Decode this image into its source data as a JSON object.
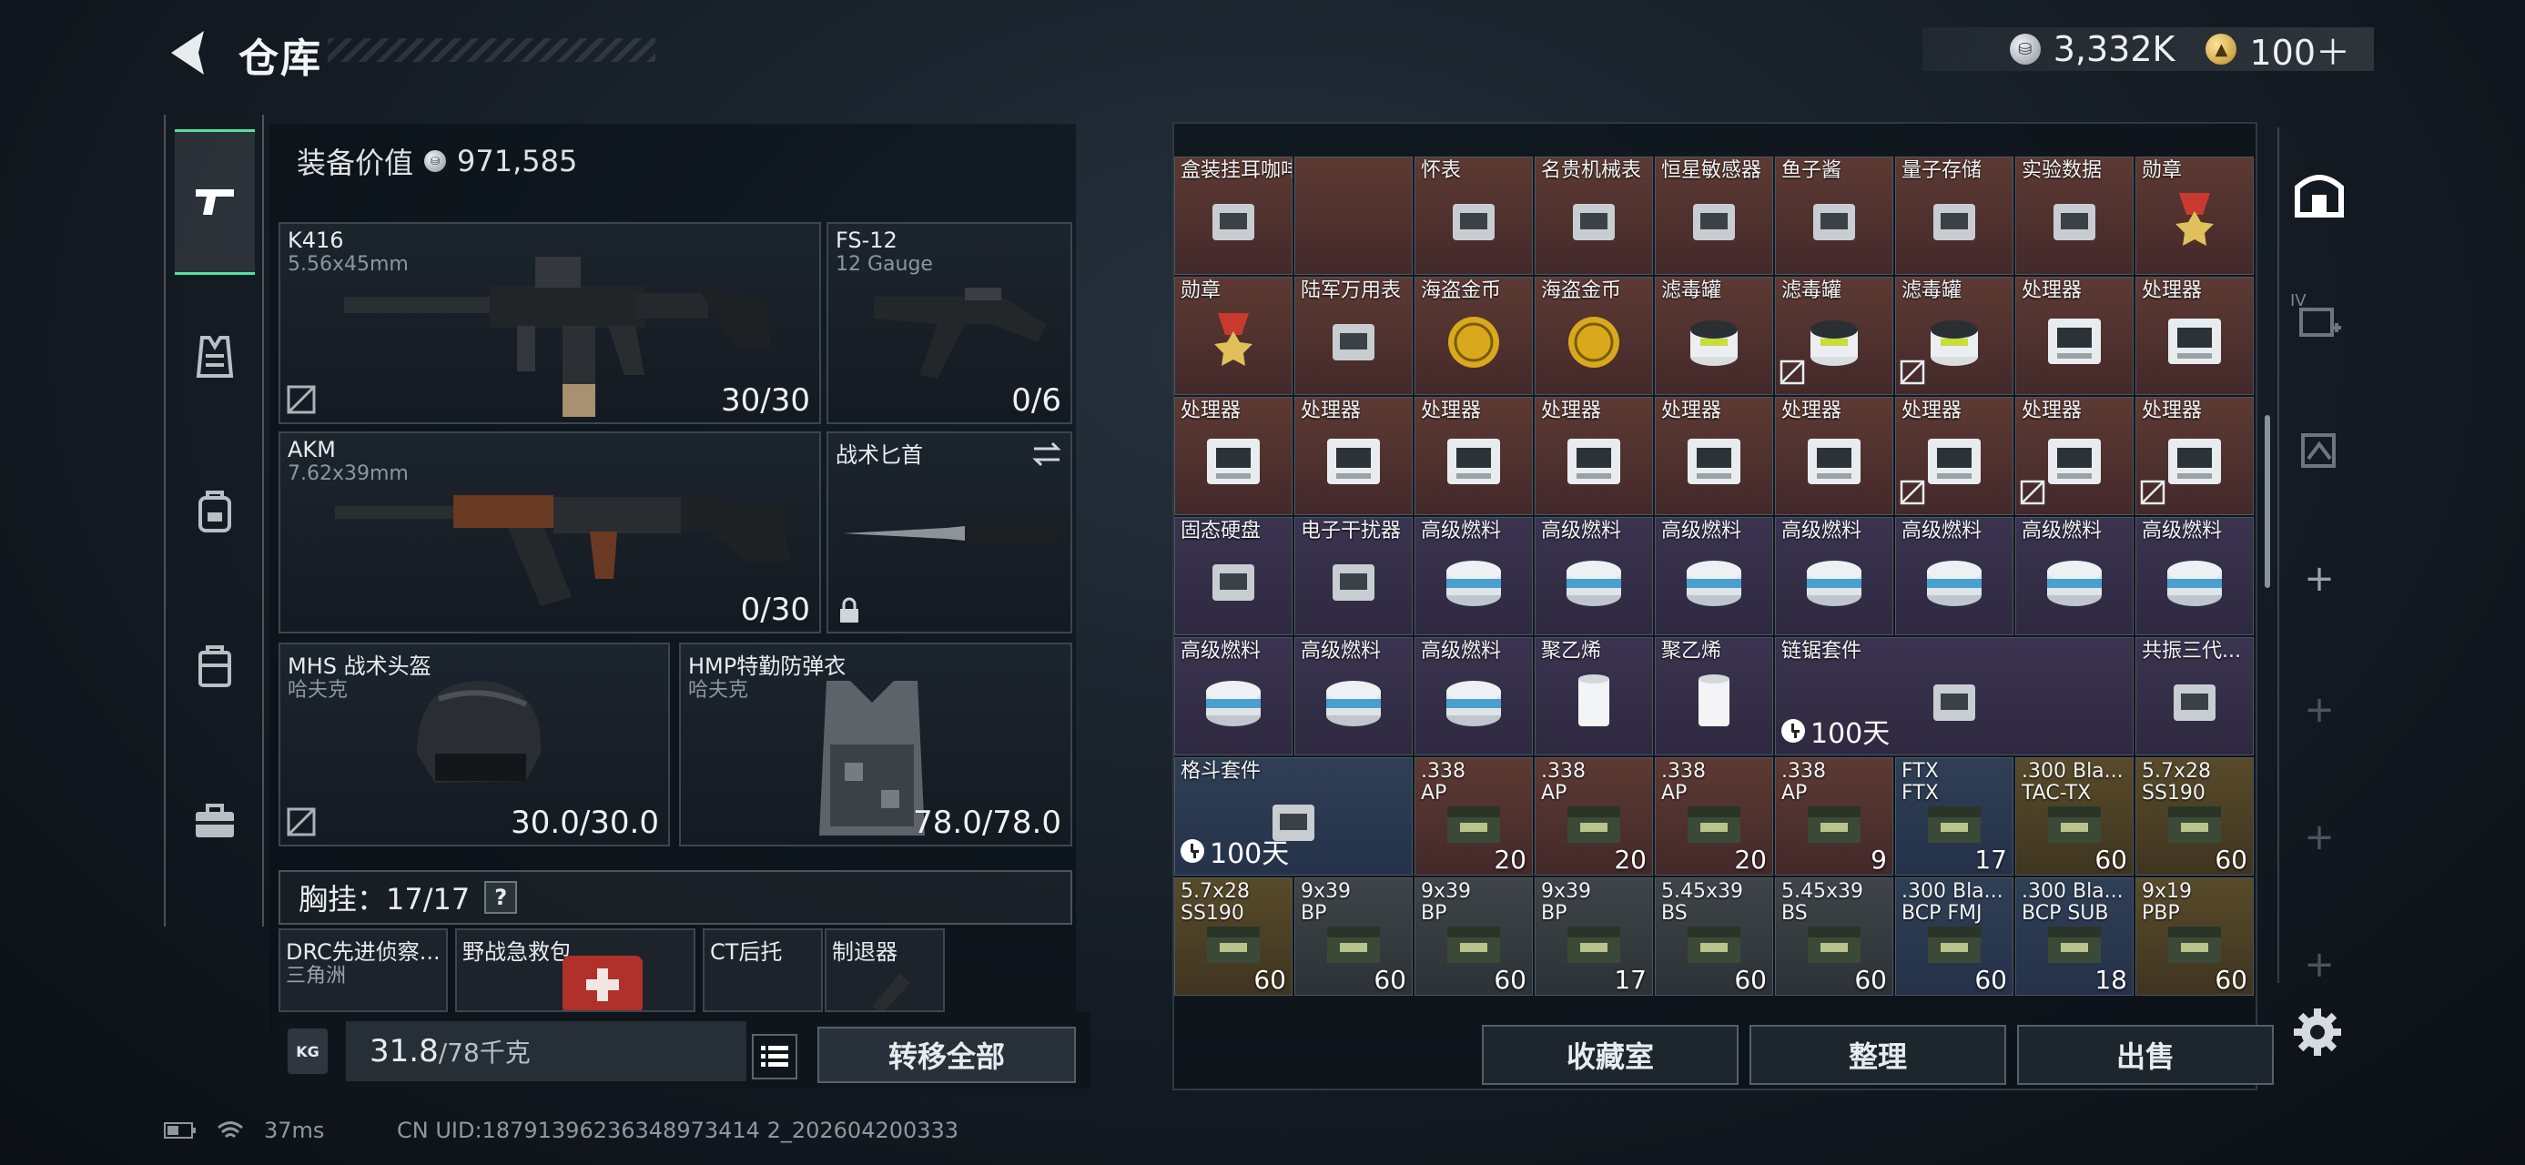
{
  "header": {
    "title": "仓库",
    "silver": "3,332K",
    "gold": "100＋"
  },
  "loadout": {
    "equip_value_label": "装备价值",
    "equip_value": "971,585",
    "slots": {
      "primary": {
        "name": "K416",
        "sub": "5.56x45mm",
        "count": "30/30"
      },
      "secondary": {
        "name": "FS-12",
        "sub": "12 Gauge",
        "count": "0/6"
      },
      "primary2": {
        "name": "AKM",
        "sub": "7.62x39mm",
        "count": "0/30"
      },
      "melee": {
        "name": "战术匕首"
      },
      "helmet": {
        "name": "MHS 战术头盔",
        "sub": "哈夫克",
        "count": "30.0/30.0"
      },
      "armor": {
        "name": "HMP特勤防弹衣",
        "sub": "哈夫克",
        "count": "78.0/78.0"
      }
    },
    "rig_label": "胸挂：17/17",
    "rig_help": "?",
    "pockets": [
      {
        "name": "DRC先进侦察...",
        "sub": "三角洲"
      },
      {
        "name": "野战急救包"
      },
      {
        "name": "CT后托"
      },
      {
        "name": "制退器"
      }
    ],
    "weight_icon": "KG",
    "weight_current": "31.8",
    "weight_max": "/78千克",
    "transfer_all": "转移全部"
  },
  "stash": {
    "rows": [
      [
        {
          "name": "盒装挂耳咖啡",
          "bg": "r",
          "icon": "coffee-box-icon"
        },
        {
          "name": "",
          "bg": "r",
          "icon": ""
        },
        {
          "name": "怀表",
          "bg": "r",
          "icon": "pocket-watch-icon"
        },
        {
          "name": "名贵机械表",
          "bg": "r",
          "icon": "luxury-watch-icon"
        },
        {
          "name": "恒星敏感器",
          "bg": "r",
          "icon": "star-sensor-icon"
        },
        {
          "name": "鱼子酱",
          "bg": "r",
          "icon": "caviar-icon"
        },
        {
          "name": "量子存储",
          "bg": "r",
          "icon": "quantum-storage-icon"
        },
        {
          "name": "实验数据",
          "bg": "r",
          "icon": "data-disc-icon"
        },
        {
          "name": "勋章",
          "bg": "r",
          "icon": "medal-icon"
        }
      ],
      [
        {
          "name": "勋章",
          "bg": "r",
          "icon": "medal-icon"
        },
        {
          "name": "陆军万用表",
          "bg": "r",
          "icon": "multimeter-icon"
        },
        {
          "name": "海盗金币",
          "bg": "r",
          "icon": "gold-coin-icon"
        },
        {
          "name": "海盗金币",
          "bg": "r",
          "icon": "gold-coin-icon"
        },
        {
          "name": "滤毒罐",
          "bg": "r",
          "icon": "filter-canister-icon"
        },
        {
          "name": "滤毒罐",
          "bg": "r",
          "icon": "filter-canister-icon",
          "mark": true
        },
        {
          "name": "滤毒罐",
          "bg": "r",
          "icon": "filter-canister-icon",
          "mark": true
        },
        {
          "name": "处理器",
          "bg": "r",
          "icon": "processor-icon"
        },
        {
          "name": "处理器",
          "bg": "r",
          "icon": "processor-icon"
        }
      ],
      [
        {
          "name": "处理器",
          "bg": "r",
          "icon": "processor-icon"
        },
        {
          "name": "处理器",
          "bg": "r",
          "icon": "processor-icon"
        },
        {
          "name": "处理器",
          "bg": "r",
          "icon": "processor-icon"
        },
        {
          "name": "处理器",
          "bg": "r",
          "icon": "processor-icon"
        },
        {
          "name": "处理器",
          "bg": "r",
          "icon": "processor-icon"
        },
        {
          "name": "处理器",
          "bg": "r",
          "icon": "processor-icon"
        },
        {
          "name": "处理器",
          "bg": "r",
          "icon": "processor-icon",
          "mark": true
        },
        {
          "name": "处理器",
          "bg": "r",
          "icon": "processor-icon",
          "mark": true
        },
        {
          "name": "处理器",
          "bg": "r",
          "icon": "processor-icon",
          "mark": true
        }
      ],
      [
        {
          "name": "固态硬盘",
          "bg": "p",
          "icon": "ssd-icon"
        },
        {
          "name": "电子干扰器",
          "bg": "p",
          "icon": "jammer-icon"
        },
        {
          "name": "高级燃料",
          "bg": "p",
          "icon": "fuel-can-icon"
        },
        {
          "name": "高级燃料",
          "bg": "p",
          "icon": "fuel-can-icon"
        },
        {
          "name": "高级燃料",
          "bg": "p",
          "icon": "fuel-can-icon"
        },
        {
          "name": "高级燃料",
          "bg": "p",
          "icon": "fuel-can-icon"
        },
        {
          "name": "高级燃料",
          "bg": "p",
          "icon": "fuel-can-icon"
        },
        {
          "name": "高级燃料",
          "bg": "p",
          "icon": "fuel-can-icon"
        },
        {
          "name": "高级燃料",
          "bg": "p",
          "icon": "fuel-can-icon"
        }
      ],
      [
        {
          "name": "高级燃料",
          "bg": "p",
          "icon": "fuel-can-icon"
        },
        {
          "name": "高级燃料",
          "bg": "p",
          "icon": "fuel-can-icon"
        },
        {
          "name": "高级燃料",
          "bg": "p",
          "icon": "fuel-can-icon"
        },
        {
          "name": "聚乙烯",
          "bg": "p",
          "icon": "polyethylene-roll-icon"
        },
        {
          "name": "聚乙烯",
          "bg": "p",
          "icon": "polyethylene-roll-icon"
        },
        {
          "name": "链锯套件",
          "bg": "p",
          "icon": "chainsaw-kit-icon",
          "span": 3,
          "timer": "100天"
        },
        null,
        null,
        {
          "name": "共振三代...",
          "bg": "p",
          "icon": "foregrip-icon"
        }
      ],
      [
        {
          "name": "格斗套件",
          "bg": "b",
          "icon": "combat-kit-icon",
          "span": 2,
          "timer": "100天"
        },
        null,
        {
          "name": ".338",
          "name2": "AP",
          "bg": "r",
          "icon": "ammo-box-icon",
          "qty": "20"
        },
        {
          "name": ".338",
          "name2": "AP",
          "bg": "r",
          "icon": "ammo-box-icon",
          "qty": "20"
        },
        {
          "name": ".338",
          "name2": "AP",
          "bg": "r",
          "icon": "ammo-box-icon",
          "qty": "20"
        },
        {
          "name": ".338",
          "name2": "AP",
          "bg": "r",
          "icon": "ammo-box-icon",
          "qty": "9"
        },
        {
          "name": "FTX",
          "name2": "FTX",
          "bg": "b",
          "icon": "ammo-box-icon",
          "qty": "17"
        },
        {
          "name": ".300 Bla...",
          "name2": "TAC-TX",
          "bg": "y",
          "icon": "ammo-box-icon",
          "qty": "60"
        },
        {
          "name": "5.7x28",
          "name2": "SS190",
          "bg": "y",
          "icon": "ammo-box-icon",
          "qty": "60"
        }
      ],
      [
        {
          "name": "5.7x28",
          "name2": "SS190",
          "bg": "y",
          "icon": "ammo-box-icon",
          "qty": "60"
        },
        {
          "name": "9x39",
          "name2": "BP",
          "bg": "g",
          "icon": "ammo-box-icon",
          "qty": "60"
        },
        {
          "name": "9x39",
          "name2": "BP",
          "bg": "g",
          "icon": "ammo-box-icon",
          "qty": "60"
        },
        {
          "name": "9x39",
          "name2": "BP",
          "bg": "g",
          "icon": "ammo-box-icon",
          "qty": "17"
        },
        {
          "name": "5.45x39",
          "name2": "BS",
          "bg": "g",
          "icon": "ammo-box-icon",
          "qty": "60"
        },
        {
          "name": "5.45x39",
          "name2": "BS",
          "bg": "g",
          "icon": "ammo-box-icon",
          "qty": "60"
        },
        {
          "name": ".300 Bla...",
          "name2": "BCP FMJ",
          "bg": "b",
          "icon": "ammo-box-icon",
          "qty": "60"
        },
        {
          "name": ".300 Bla...",
          "name2": "BCP SUB",
          "bg": "b",
          "icon": "ammo-box-icon",
          "qty": "18"
        },
        {
          "name": "9x19",
          "name2": "PBP",
          "bg": "y",
          "icon": "ammo-box-icon",
          "qty": "60"
        }
      ]
    ],
    "buttons": {
      "collection": "收藏室",
      "sort": "整理",
      "sell": "出售"
    }
  },
  "right_tabs": {
    "tier_label": "IV"
  },
  "status": {
    "ping": "37ms",
    "uid": "CN UID:18791396236348973414 2_202604200333"
  },
  "colors": {
    "accent_green": "#4fe3a2",
    "rare_red": "#5d3a33",
    "epic_purple": "#3a3450",
    "blue": "#2f3f55",
    "gold": "#584a2a"
  }
}
